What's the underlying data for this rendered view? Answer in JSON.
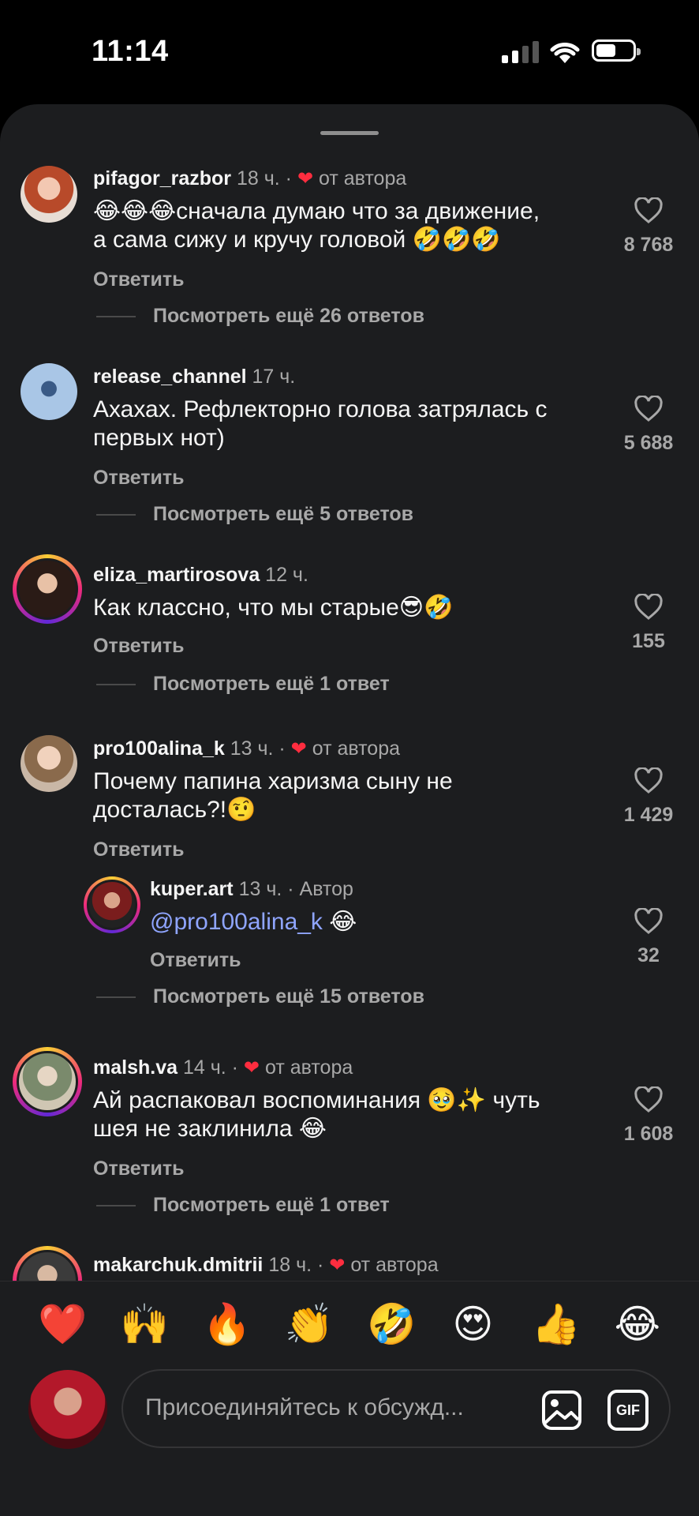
{
  "status_bar": {
    "time": "11:14"
  },
  "comments": [
    {
      "user": "pifagor_razbor",
      "time": "18 ч.",
      "badge": "от автора",
      "text_l1": "😂😂😂сначала думаю что за движение,",
      "text_l2": "а сама сижу и кручу головой 🤣🤣🤣",
      "reply": "Ответить",
      "likes": "8 768",
      "more": "Посмотреть ещё 26 ответов"
    },
    {
      "user": "release_channel",
      "time": "17 ч.",
      "text_l1": "Ахахах. Рефлекторно голова затрялась с",
      "text_l2": "первых нот)",
      "reply": "Ответить",
      "likes": "5 688",
      "more": "Посмотреть ещё 5 ответов"
    },
    {
      "user": "eliza_martirosova",
      "time": "12 ч.",
      "text_l1": "Как классно, что мы старые😎🤣",
      "reply": "Ответить",
      "likes": "155",
      "more": "Посмотреть ещё 1 ответ"
    },
    {
      "user": "pro100alina_k",
      "time": "13 ч.",
      "badge": "от автора",
      "text_l1": "Почему папина харизма сыну не",
      "text_l2": "досталась?!🤨",
      "reply": "Ответить",
      "likes": "1 429",
      "sub": {
        "user": "kuper.art",
        "time": "13 ч.",
        "badge": "Автор",
        "mention": "@pro100alina_k",
        "text_tail": " 😂",
        "reply": "Ответить",
        "likes": "32"
      },
      "more": "Посмотреть ещё 15 ответов"
    },
    {
      "user": "malsh.va",
      "time": "14 ч.",
      "badge": "от автора",
      "text_l1": "Ай распаковал воспоминания 🥹✨ чуть",
      "text_l2": "шея не заклинила 😂",
      "reply": "Ответить",
      "likes": "1 608",
      "more": "Посмотреть ещё 1 ответ"
    },
    {
      "user": "makarchuk.dmitrii",
      "time": "18 ч.",
      "badge": "от автора"
    }
  ],
  "emoji_reactions": [
    "❤️",
    "🙌",
    "🔥",
    "👏",
    "🤣",
    "😍",
    "👍",
    "😂"
  ],
  "composer": {
    "placeholder": "Присоединяйтесь к обсужд...",
    "gif_label": "GIF"
  },
  "colors": {
    "background": "#1c1d1f",
    "text": "#f5f5f5",
    "muted": "#a8a8a8",
    "like_heart": "#ff2d3f",
    "mention": "#8fa5ff"
  },
  "icons": [
    "signal-icon",
    "wifi-icon",
    "battery-icon",
    "heart-outline-icon",
    "heart-filled-icon",
    "image-icon",
    "gif-icon"
  ]
}
